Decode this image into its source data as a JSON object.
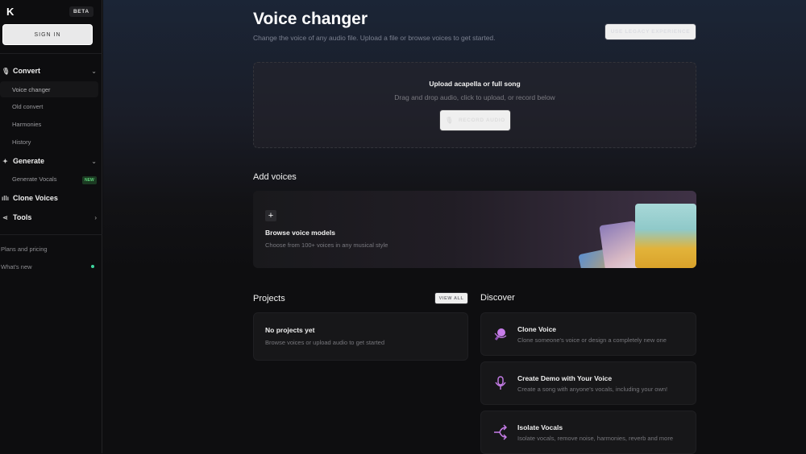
{
  "sidebar": {
    "logo": "K",
    "beta": "BETA",
    "sign_in": "SIGN IN",
    "convert": {
      "label": "Convert",
      "items": [
        "Voice changer",
        "Old convert",
        "Harmonies",
        "History"
      ]
    },
    "generate": {
      "label": "Generate",
      "items": [
        "Generate Vocals"
      ],
      "badge": "NEW"
    },
    "clone_voices": "Clone Voices",
    "tools": "Tools",
    "plans": "Plans and pricing",
    "whats_new": "What's new"
  },
  "header": {
    "title": "Voice changer",
    "subtitle": "Change the voice of any audio file. Upload a file or browse voices to get started.",
    "legacy_button": "USE LEGACY EXPERIENCE"
  },
  "upload": {
    "title": "Upload acapella or full song",
    "subtitle": "Drag and drop audio, click to upload, or record below",
    "record_button": "RECORD AUDIO"
  },
  "add_voices": {
    "heading": "Add voices",
    "title": "Browse voice models",
    "subtitle": "Choose from 100+ voices in any musical style"
  },
  "projects": {
    "heading": "Projects",
    "view_all": "VIEW ALL",
    "empty_title": "No projects yet",
    "empty_subtitle": "Browse voices or upload audio to get started"
  },
  "discover": {
    "heading": "Discover",
    "accent": "#c77dea",
    "items": [
      {
        "title": "Clone Voice",
        "subtitle": "Clone someone's voice or design a completely new one",
        "icon": "clone-voice-icon"
      },
      {
        "title": "Create Demo with Your Voice",
        "subtitle": "Create a song with anyone's vocals, including your own!",
        "icon": "microphone-icon"
      },
      {
        "title": "Isolate Vocals",
        "subtitle": "Isolate vocals, remove noise, harmonies, reverb and more",
        "icon": "split-arrows-icon"
      }
    ]
  }
}
